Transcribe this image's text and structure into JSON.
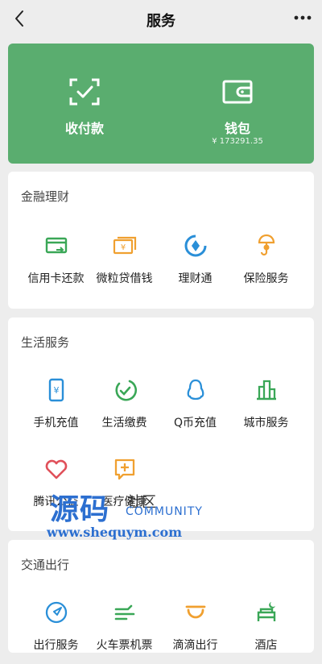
{
  "header": {
    "title": "服务"
  },
  "wallet_card": {
    "pay_label": "收付款",
    "wallet_label": "钱包",
    "wallet_balance": "¥ 173291.35"
  },
  "sections": {
    "finance": {
      "title": "金融理财",
      "items": [
        "信用卡还款",
        "微粒贷借钱",
        "理财通",
        "保险服务"
      ]
    },
    "life": {
      "title": "生活服务",
      "items": [
        "手机充值",
        "生活缴费",
        "Q币充值",
        "城市服务",
        "腾讯公益",
        "医疗健康"
      ]
    },
    "travel": {
      "title": "交通出行",
      "items": [
        "出行服务",
        "火车票机票",
        "滴滴出行",
        "酒店"
      ]
    }
  },
  "watermark": {
    "brand": "源码",
    "brand_suffix": "社区",
    "community": "COMMUNITY",
    "url": "www.shequym.com"
  },
  "colors": {
    "card_green": "#5aad6f",
    "icon_green": "#3aa757",
    "icon_orange": "#f0a030",
    "icon_blue": "#2a8fd8",
    "icon_red": "#e0505a"
  },
  "icons": [
    "back-icon",
    "more-icon",
    "scan-pay-icon",
    "wallet-icon",
    "credit-card-icon",
    "loan-icon",
    "wealth-icon",
    "insurance-icon",
    "phone-topup-icon",
    "utilities-icon",
    "qq-coin-icon",
    "city-service-icon",
    "charity-icon",
    "medical-icon",
    "navigation-icon",
    "train-plane-icon",
    "didi-icon",
    "hotel-icon"
  ]
}
